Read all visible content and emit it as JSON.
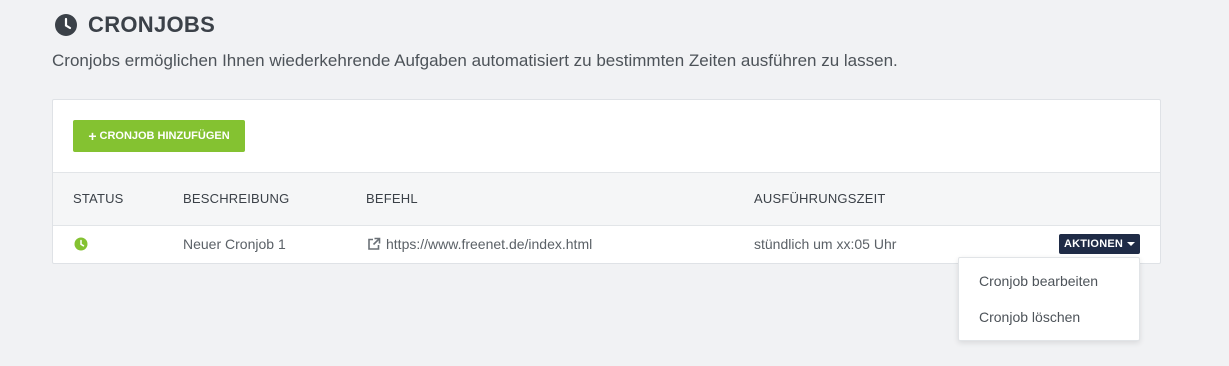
{
  "page": {
    "title": "CRONJOBS",
    "subtitle": "Cronjobs ermöglichen Ihnen wiederkehrende Aufgaben automatisiert zu bestimmten Zeiten ausführen zu lassen."
  },
  "icons": {
    "title": "clock-icon",
    "status": "clock-icon",
    "command_link": "external-link-icon",
    "actions_caret": "caret-down-icon",
    "add_button": "plus-icon"
  },
  "colors": {
    "accent_green": "#84c231",
    "actions_button": "#1f2b46",
    "status_active": "#84c231"
  },
  "toolbar": {
    "add_label": "CRONJOB HINZUFÜGEN"
  },
  "table": {
    "columns": {
      "status": "STATUS",
      "description": "BESCHREIBUNG",
      "command": "BEFEHL",
      "execution_time": "AUSFÜHRUNGSZEIT"
    },
    "rows": [
      {
        "status": "active",
        "description": "Neuer Cronjob 1",
        "command": "https://www.freenet.de/index.html",
        "execution_time": "stündlich um xx:05 Uhr",
        "actions_label": "AKTIONEN"
      }
    ]
  },
  "actions_menu": {
    "items": [
      "Cronjob bearbeiten",
      "Cronjob löschen"
    ]
  }
}
